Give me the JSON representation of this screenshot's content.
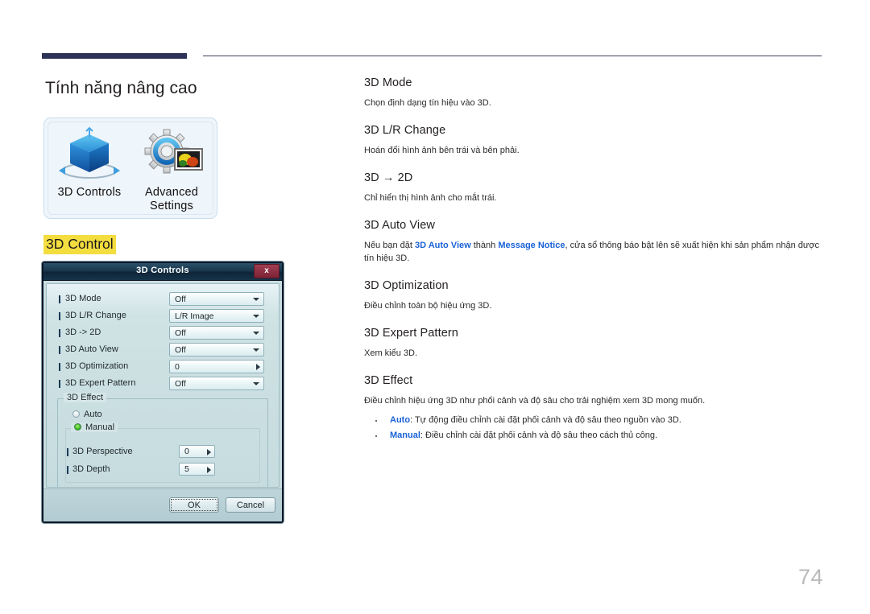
{
  "page": {
    "title": "Tính năng nâng cao",
    "number": "74"
  },
  "icon_panel": {
    "items": [
      {
        "label": "3D Controls",
        "icon": "3d-cube-icon"
      },
      {
        "label": "Advanced\nSettings",
        "icon": "gear-picture-icon"
      }
    ],
    "item1_label": "3D Controls",
    "item2_label_line1": "Advanced",
    "item2_label_line2": "Settings"
  },
  "caption": {
    "text": "3D Control",
    "highlight_color": "#f4dd3f"
  },
  "dialog": {
    "title": "3D Controls",
    "close_label": "x",
    "rows": [
      {
        "label": "3D Mode",
        "value": "Off",
        "control": "combo"
      },
      {
        "label": "3D L/R Change",
        "value": "L/R Image",
        "control": "combo"
      },
      {
        "label": "3D -> 2D",
        "value": "Off",
        "control": "combo"
      },
      {
        "label": "3D Auto View",
        "value": "Off",
        "control": "combo"
      },
      {
        "label": "3D Optimization",
        "value": "0",
        "control": "stepper"
      },
      {
        "label": "3D Expert Pattern",
        "value": "Off",
        "control": "combo"
      }
    ],
    "effect_group": {
      "legend": "3D Effect",
      "auto_label": "Auto",
      "auto_selected": false,
      "manual_label": "Manual",
      "manual_selected": true,
      "manual_rows": [
        {
          "label": "3D Perspective",
          "value": "0"
        },
        {
          "label": "3D Depth",
          "value": "5"
        }
      ]
    },
    "buttons": {
      "ok": "OK",
      "cancel": "Cancel"
    }
  },
  "content": {
    "sections": [
      {
        "heading": "3D Mode",
        "body": "Chọn định dạng tín hiệu vào 3D."
      },
      {
        "heading": "3D L/R Change",
        "body": "Hoán đổi hình ảnh bên trái và bên phải."
      },
      {
        "heading": "3D → 2D",
        "body": "Chỉ hiển thị hình ảnh cho mắt trái."
      },
      {
        "heading": "3D Auto View",
        "body_part1": "Nếu bạn đặt ",
        "body_link1": "3D Auto View",
        "body_part2": " thành ",
        "body_link2": "Message Notice",
        "body_part3": ", cửa sổ thông báo bật lên sẽ xuất hiện khi sản phẩm nhận được tín hiệu 3D."
      },
      {
        "heading": "3D Optimization",
        "body": "Điều chỉnh toàn bộ hiệu ứng 3D."
      },
      {
        "heading": "3D Expert Pattern",
        "body": "Xem kiểu 3D."
      },
      {
        "heading": "3D Effect",
        "body": "Điều chỉnh hiệu ứng 3D như phối cảnh và độ sâu cho trải nghiệm xem 3D mong muốn.",
        "bullets": [
          {
            "term": "Auto",
            "text": ": Tự động điều chỉnh cài đặt phối cảnh và độ sâu theo nguồn vào 3D."
          },
          {
            "term": "Manual",
            "text": ": Điều chỉnh cài đặt phối cảnh và độ sâu theo cách thủ công."
          }
        ]
      }
    ]
  }
}
